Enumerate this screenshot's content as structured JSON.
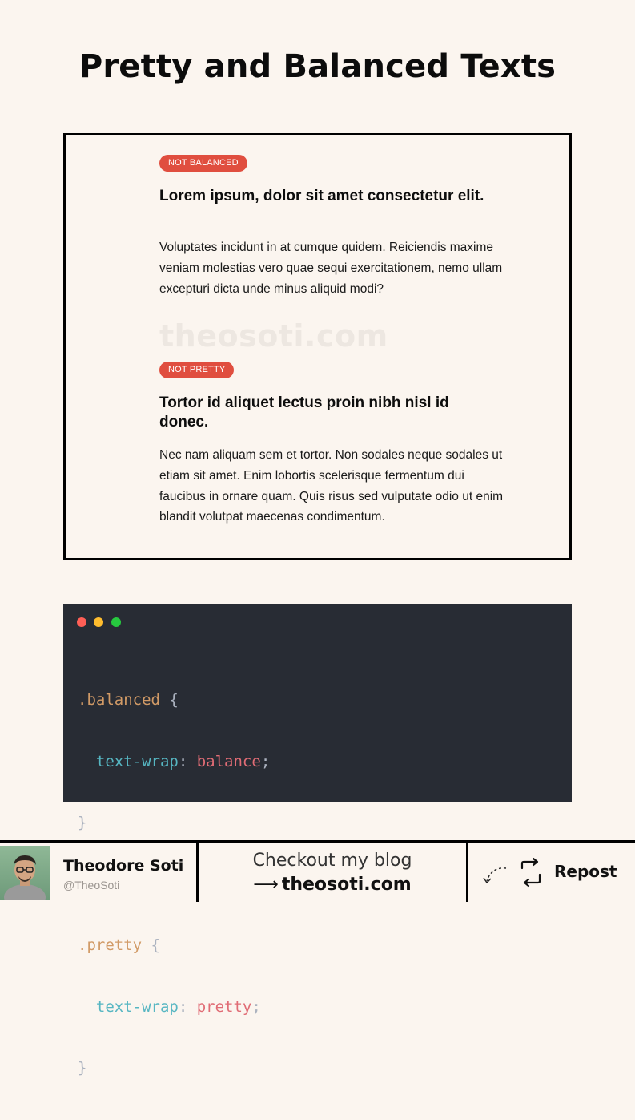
{
  "page": {
    "title": "Pretty and Balanced Texts"
  },
  "demo": {
    "watermark": "theosoti.com",
    "sections": [
      {
        "badge": "NOT BALANCED",
        "heading": "Lorem ipsum, dolor sit amet consectetur elit.",
        "paragraph": "Voluptates incidunt in at cumque quidem. Reiciendis maxime veniam molestias vero quae sequi exercitationem, nemo ullam excepturi dicta unde minus aliquid modi?"
      },
      {
        "badge": "NOT PRETTY",
        "heading": "Tortor id aliquet lectus proin nibh nisl id donec.",
        "paragraph": "Nec nam aliquam sem et tortor. Non sodales neque sodales ut etiam sit amet. Enim lobortis scelerisque fermentum dui faucibus in ornare quam. Quis risus sed vulputate odio ut enim blandit volutpat maecenas condimentum."
      }
    ],
    "colors": {
      "badge": "#e04e3f"
    }
  },
  "code": {
    "window_dots": [
      "#ff5f56",
      "#ffbd2e",
      "#27c93f"
    ],
    "rules": [
      {
        "selector": ".balanced",
        "open": " {",
        "property": "text-wrap",
        "colon": ": ",
        "value": "balance",
        "semi": ";",
        "close": "}"
      },
      {
        "selector": ".pretty",
        "open": " {",
        "property": "text-wrap",
        "colon": ": ",
        "value": "pretty",
        "semi": ";",
        "close": "}"
      }
    ]
  },
  "footer": {
    "author_name": "Theodore Soti",
    "author_handle": "@TheoSoti",
    "cta_line": "Checkout my blog",
    "arrow": "⟶",
    "blog_url": "theosoti.com",
    "repost_label": "Repost",
    "repost_icon": "repost-icon",
    "curved_arrow_icon": "curved-arrow-icon"
  }
}
